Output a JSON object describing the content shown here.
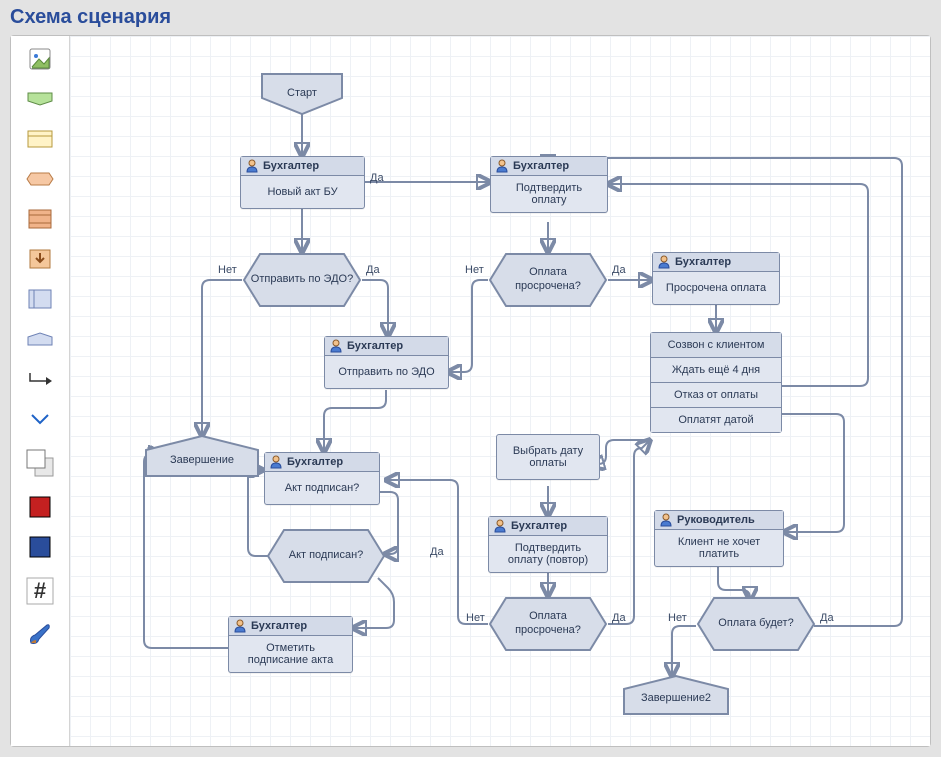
{
  "title": "Схема сценария",
  "labels": {
    "yes": "Да",
    "no": "Нет"
  },
  "palette": {
    "items": [
      {
        "name": "image-icon"
      },
      {
        "name": "start-node-icon"
      },
      {
        "name": "task-node-icon"
      },
      {
        "name": "decision-node-icon"
      },
      {
        "name": "stack-icon"
      },
      {
        "name": "import-icon"
      },
      {
        "name": "container-icon"
      },
      {
        "name": "end-node-icon"
      },
      {
        "name": "connector-icon"
      }
    ],
    "formatting": [
      {
        "name": "layer-back-icon"
      },
      {
        "name": "fill-red-icon"
      },
      {
        "name": "fill-blue-icon"
      },
      {
        "name": "grid-snap-icon"
      },
      {
        "name": "brush-icon"
      }
    ]
  },
  "nodes": {
    "start": {
      "label": "Старт"
    },
    "new_act": {
      "role": "Бухгалтер",
      "label": "Новый акт БУ"
    },
    "send_edo_q": {
      "label": "Отправить по ЭДО?"
    },
    "send_edo": {
      "role": "Бухгалтер",
      "label": "Отправить по ЭДО"
    },
    "end1": {
      "label": "Завершение"
    },
    "act_signed_task": {
      "role": "Бухгалтер",
      "label": "Акт подписан?"
    },
    "act_signed_q": {
      "label": "Акт подписан?"
    },
    "mark_signed": {
      "role": "Бухгалтер",
      "label": "Отметить подписание акта"
    },
    "confirm_pay": {
      "role": "Бухгалтер",
      "label": "Подтвердить оплату"
    },
    "overdue1_q": {
      "label": "Оплата просрочена?"
    },
    "overdue_task": {
      "role": "Бухгалтер",
      "label": "Просрочена оплата"
    },
    "select_date": {
      "label": "Выбрать дату оплаты"
    },
    "confirm_pay2": {
      "role": "Бухгалтер",
      "label": "Подтвердить оплату (повтор)"
    },
    "overdue2_q": {
      "label": "Оплата просрочена?"
    },
    "call_menu": {
      "title": "Созвон с клиентом",
      "items": [
        "Ждать ещё 4 дня",
        "Отказ от оплаты",
        "Оплатят датой"
      ]
    },
    "client_refuse": {
      "role": "Руководитель",
      "label": "Клиент не хочет платить"
    },
    "will_pay_q": {
      "label": "Оплата будет?"
    },
    "end2": {
      "label": "Завершение2"
    }
  },
  "edge_labels": {
    "eL1": "Да",
    "eL2": "Нет",
    "eL3": "Да",
    "eL4": "Нет",
    "eL5": "Да",
    "eL6": "Да",
    "eL7": "Нет",
    "eL8": "Да",
    "eL9": "Нет",
    "eL10": "Да",
    "eL11": "Нет"
  }
}
